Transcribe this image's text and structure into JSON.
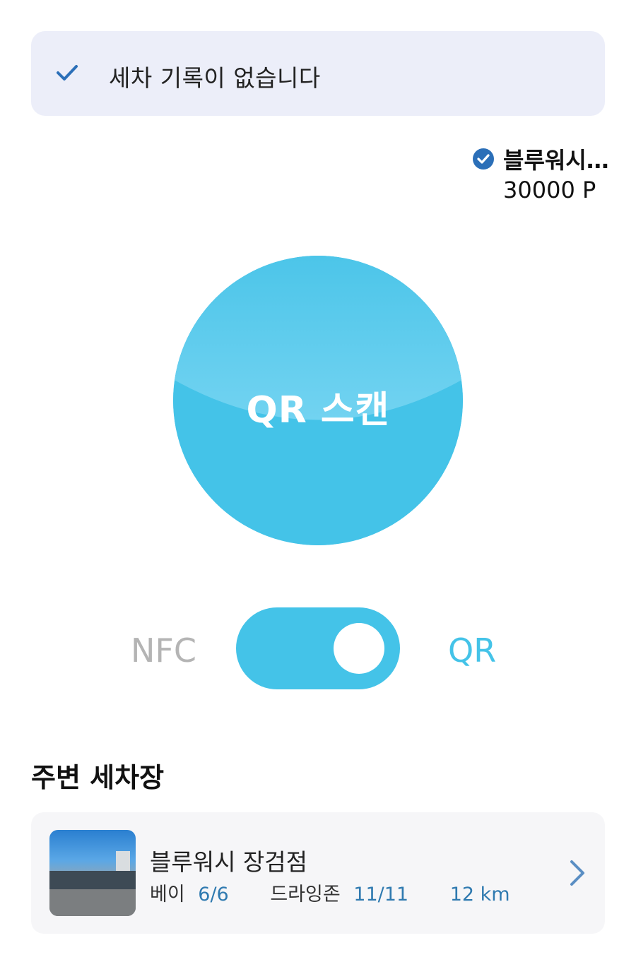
{
  "banner": {
    "text": "세차 기록이 없습니다",
    "icon": "check-icon"
  },
  "membership": {
    "name": "블루워시...",
    "points": "30000 P",
    "icon": "check-badge-icon"
  },
  "scan": {
    "label": "QR 스캔"
  },
  "mode_toggle": {
    "left_label": "NFC",
    "right_label": "QR",
    "selected": "QR"
  },
  "nearby": {
    "title": "주변 세차장",
    "stations": [
      {
        "name": "블루워시 장검점",
        "bay_label": "베이",
        "bay_value": "6/6",
        "drying_label": "드라잉존",
        "drying_value": "11/11",
        "distance": "12 km"
      }
    ]
  },
  "colors": {
    "accent": "#44c3e8",
    "banner_bg": "#eceef9",
    "check_blue": "#2b6fb8",
    "info_blue": "#2f7ab0",
    "muted": "#b4b4b4"
  }
}
